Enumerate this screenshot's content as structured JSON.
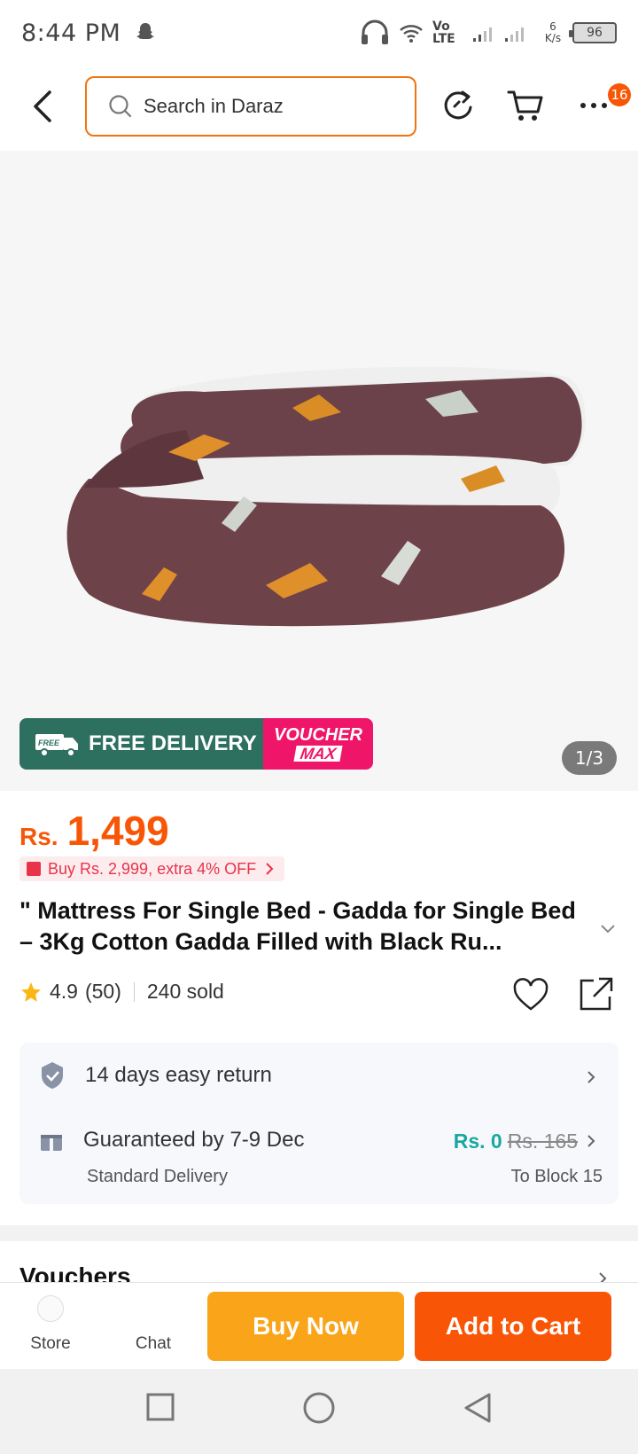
{
  "status_bar": {
    "time": "8:44 PM",
    "network": "Vo LTE",
    "speed": "6 K/s",
    "battery": "96"
  },
  "header": {
    "search_placeholder": "Search in Daraz",
    "cart_badge": "16"
  },
  "gallery": {
    "promo_free_delivery": "FREE DELIVERY",
    "promo_free_tag": "FREE",
    "promo_voucher": "VOUCHER",
    "promo_max": "MAX",
    "counter": "1/3"
  },
  "product": {
    "currency": "Rs.",
    "price": "1,499",
    "deal": "Buy Rs. 2,999, extra 4% OFF",
    "title": "\" Mattress For Single Bed - Gadda for Single Bed – 3Kg Cotton Gadda Filled with Black Ru...",
    "rating": "4.9",
    "reviews": "(50)",
    "sold": "240 sold"
  },
  "info": {
    "return_text": "14 days easy return",
    "delivery_text": "Guaranteed by 7-9 Dec",
    "delivery_type": "Standard Delivery",
    "shipping_price": "Rs. 0",
    "shipping_old_price": "Rs. 165",
    "destination": "To Block 15"
  },
  "vouchers_title": "Vouchers",
  "actions": {
    "store_label": "Store",
    "chat_label": "Chat",
    "buy_now": "Buy Now",
    "add_to_cart": "Add to Cart"
  },
  "colors": {
    "accent": "#f85606",
    "buy_now": "#faa41a",
    "free_delivery": "#2e7060",
    "voucher": "#ef1669",
    "shipping_free": "#1aa7a1"
  }
}
